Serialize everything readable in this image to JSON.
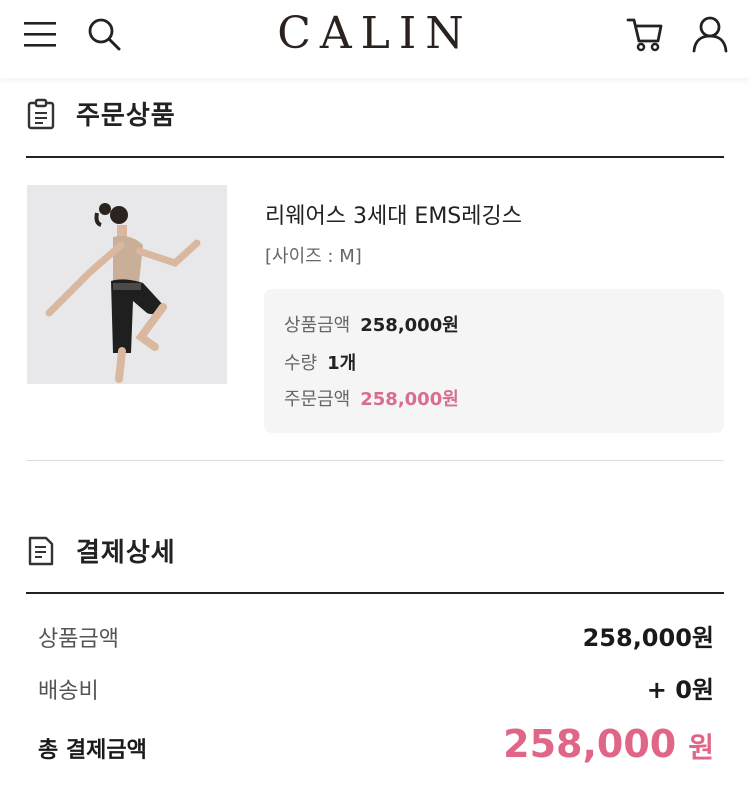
{
  "header": {
    "logo": "CALIN",
    "icons": [
      "menu-icon",
      "search-icon",
      "cart-icon",
      "user-icon"
    ]
  },
  "order_section": {
    "title": "주문상품",
    "icon": "clipboard-icon",
    "product": {
      "name": "리웨어스 3세대 EMS레깅스",
      "option": "[사이즈 : M]",
      "price_label": "상품금액",
      "price_value": "258,000원",
      "qty_label": "수량",
      "qty_value": "1개",
      "order_label": "주문금액",
      "order_value": "258,000원"
    }
  },
  "payment_section": {
    "title": "결제상세",
    "icon": "document-icon",
    "rows": [
      {
        "label": "상품금액",
        "value": "258,000원"
      },
      {
        "label": "배송비",
        "value": "+ 0원"
      }
    ],
    "total_label": "총 결제금액",
    "total_value": "258,000",
    "total_unit": "원"
  },
  "colors": {
    "accent_pink": "#e06687",
    "logo": "#2a221e",
    "box_bg": "#f5f5f6"
  }
}
